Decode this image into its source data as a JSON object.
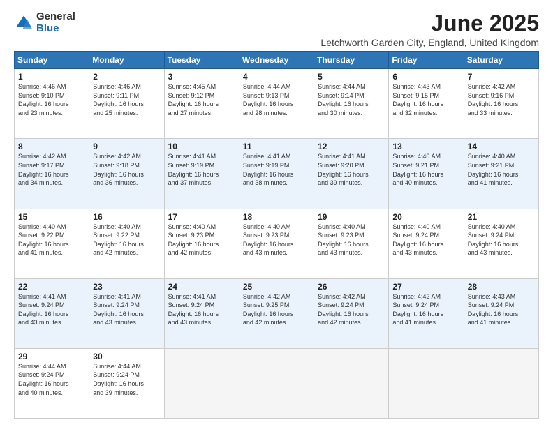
{
  "logo": {
    "general": "General",
    "blue": "Blue"
  },
  "title": "June 2025",
  "subtitle": "Letchworth Garden City, England, United Kingdom",
  "days_of_week": [
    "Sunday",
    "Monday",
    "Tuesday",
    "Wednesday",
    "Thursday",
    "Friday",
    "Saturday"
  ],
  "weeks": [
    [
      {
        "day": "1",
        "sunrise": "4:46 AM",
        "sunset": "9:10 PM",
        "daylight": "16 hours and 23 minutes."
      },
      {
        "day": "2",
        "sunrise": "4:46 AM",
        "sunset": "9:11 PM",
        "daylight": "16 hours and 25 minutes."
      },
      {
        "day": "3",
        "sunrise": "4:45 AM",
        "sunset": "9:12 PM",
        "daylight": "16 hours and 27 minutes."
      },
      {
        "day": "4",
        "sunrise": "4:44 AM",
        "sunset": "9:13 PM",
        "daylight": "16 hours and 28 minutes."
      },
      {
        "day": "5",
        "sunrise": "4:44 AM",
        "sunset": "9:14 PM",
        "daylight": "16 hours and 30 minutes."
      },
      {
        "day": "6",
        "sunrise": "4:43 AM",
        "sunset": "9:15 PM",
        "daylight": "16 hours and 32 minutes."
      },
      {
        "day": "7",
        "sunrise": "4:42 AM",
        "sunset": "9:16 PM",
        "daylight": "16 hours and 33 minutes."
      }
    ],
    [
      {
        "day": "8",
        "sunrise": "4:42 AM",
        "sunset": "9:17 PM",
        "daylight": "16 hours and 34 minutes."
      },
      {
        "day": "9",
        "sunrise": "4:42 AM",
        "sunset": "9:18 PM",
        "daylight": "16 hours and 36 minutes."
      },
      {
        "day": "10",
        "sunrise": "4:41 AM",
        "sunset": "9:19 PM",
        "daylight": "16 hours and 37 minutes."
      },
      {
        "day": "11",
        "sunrise": "4:41 AM",
        "sunset": "9:19 PM",
        "daylight": "16 hours and 38 minutes."
      },
      {
        "day": "12",
        "sunrise": "4:41 AM",
        "sunset": "9:20 PM",
        "daylight": "16 hours and 39 minutes."
      },
      {
        "day": "13",
        "sunrise": "4:40 AM",
        "sunset": "9:21 PM",
        "daylight": "16 hours and 40 minutes."
      },
      {
        "day": "14",
        "sunrise": "4:40 AM",
        "sunset": "9:21 PM",
        "daylight": "16 hours and 41 minutes."
      }
    ],
    [
      {
        "day": "15",
        "sunrise": "4:40 AM",
        "sunset": "9:22 PM",
        "daylight": "16 hours and 41 minutes."
      },
      {
        "day": "16",
        "sunrise": "4:40 AM",
        "sunset": "9:22 PM",
        "daylight": "16 hours and 42 minutes."
      },
      {
        "day": "17",
        "sunrise": "4:40 AM",
        "sunset": "9:23 PM",
        "daylight": "16 hours and 42 minutes."
      },
      {
        "day": "18",
        "sunrise": "4:40 AM",
        "sunset": "9:23 PM",
        "daylight": "16 hours and 43 minutes."
      },
      {
        "day": "19",
        "sunrise": "4:40 AM",
        "sunset": "9:23 PM",
        "daylight": "16 hours and 43 minutes."
      },
      {
        "day": "20",
        "sunrise": "4:40 AM",
        "sunset": "9:24 PM",
        "daylight": "16 hours and 43 minutes."
      },
      {
        "day": "21",
        "sunrise": "4:40 AM",
        "sunset": "9:24 PM",
        "daylight": "16 hours and 43 minutes."
      }
    ],
    [
      {
        "day": "22",
        "sunrise": "4:41 AM",
        "sunset": "9:24 PM",
        "daylight": "16 hours and 43 minutes."
      },
      {
        "day": "23",
        "sunrise": "4:41 AM",
        "sunset": "9:24 PM",
        "daylight": "16 hours and 43 minutes."
      },
      {
        "day": "24",
        "sunrise": "4:41 AM",
        "sunset": "9:24 PM",
        "daylight": "16 hours and 43 minutes."
      },
      {
        "day": "25",
        "sunrise": "4:42 AM",
        "sunset": "9:25 PM",
        "daylight": "16 hours and 42 minutes."
      },
      {
        "day": "26",
        "sunrise": "4:42 AM",
        "sunset": "9:24 PM",
        "daylight": "16 hours and 42 minutes."
      },
      {
        "day": "27",
        "sunrise": "4:42 AM",
        "sunset": "9:24 PM",
        "daylight": "16 hours and 41 minutes."
      },
      {
        "day": "28",
        "sunrise": "4:43 AM",
        "sunset": "9:24 PM",
        "daylight": "16 hours and 41 minutes."
      }
    ],
    [
      {
        "day": "29",
        "sunrise": "4:44 AM",
        "sunset": "9:24 PM",
        "daylight": "16 hours and 40 minutes."
      },
      {
        "day": "30",
        "sunrise": "4:44 AM",
        "sunset": "9:24 PM",
        "daylight": "16 hours and 39 minutes."
      },
      null,
      null,
      null,
      null,
      null
    ]
  ],
  "labels": {
    "sunrise": "Sunrise:",
    "sunset": "Sunset:",
    "daylight": "Daylight:"
  }
}
